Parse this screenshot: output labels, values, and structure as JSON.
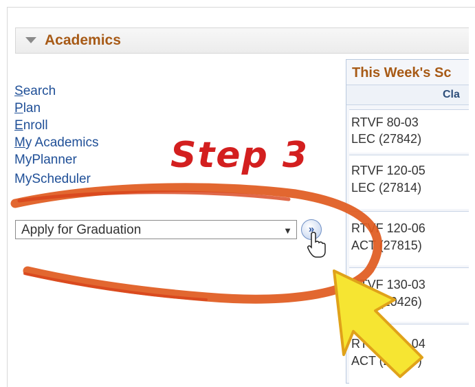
{
  "section": {
    "title": "Academics"
  },
  "nav": {
    "links": [
      {
        "first": "S",
        "rest": "earch"
      },
      {
        "first": "P",
        "rest": "lan"
      },
      {
        "first": "E",
        "rest": "nroll"
      },
      {
        "first": "M",
        "rest": "y Academics"
      },
      {
        "first": "",
        "rest": "MyPlanner"
      },
      {
        "first": "",
        "rest": "MyScheduler"
      }
    ]
  },
  "other_actions": {
    "selected": "Apply for Graduation",
    "go_symbol": "»"
  },
  "schedule": {
    "title": "This Week's Sc",
    "column_header": "Cla",
    "classes": [
      {
        "line1": "RTVF 80-03",
        "line2": "LEC (27842)"
      },
      {
        "line1": "RTVF 120-05",
        "line2": "LEC (27814)"
      },
      {
        "line1": "RTVF 120-06",
        "line2": "ACT (27815)"
      },
      {
        "line1": "RTVF 130-03",
        "line2": "ACT (20426)"
      },
      {
        "line1": "RTVF 130-04",
        "line2": "ACT (20427)"
      }
    ]
  },
  "annotation": {
    "step_label": "Step 3",
    "color": "#d31f1f",
    "arrow_color": "#f6e532"
  }
}
